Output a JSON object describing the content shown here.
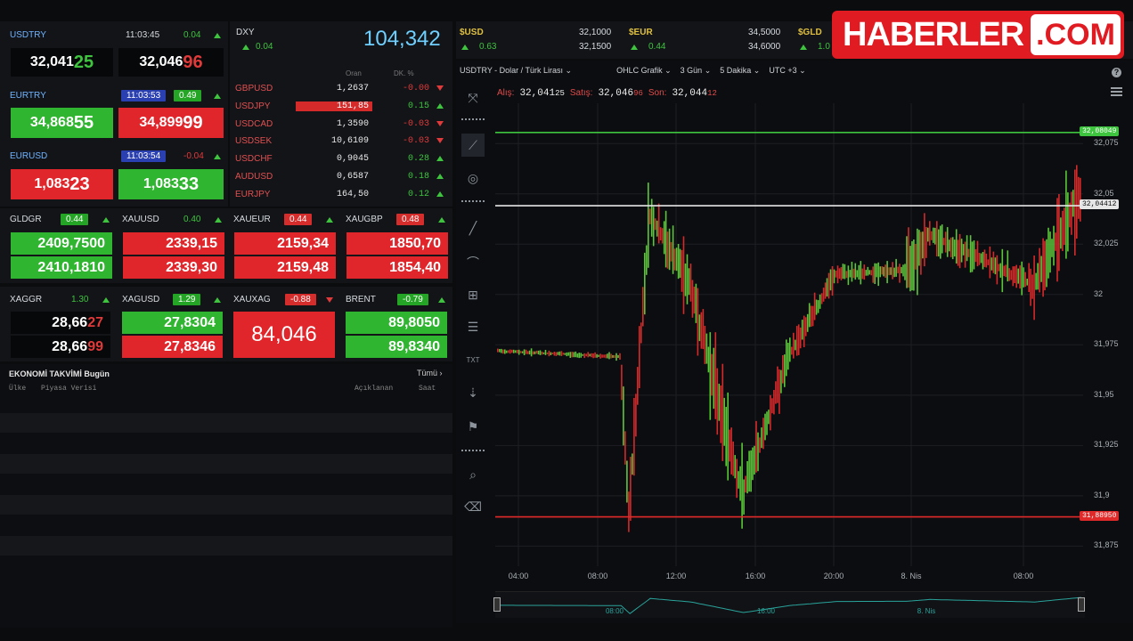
{
  "logo": {
    "brand": "HABERLER",
    "tld": ".COM"
  },
  "usdtry_card": {
    "name": "USDTRY",
    "time": "11:03:45",
    "change": "0.04",
    "bid_main": "32,041",
    "bid_tail": "25",
    "ask_main": "32,046",
    "ask_tail": "96"
  },
  "eurtry_card": {
    "name": "EURTRY",
    "time": "11:03:53",
    "change": "0.49",
    "bid_main": "34,868",
    "bid_tail": "55",
    "ask_main": "34,899",
    "ask_tail": "99"
  },
  "eurusd_card": {
    "name": "EURUSD",
    "time": "11:03:54",
    "change": "-0.04",
    "bid_main": "1,083",
    "bid_tail": "23",
    "ask_main": "1,083",
    "ask_tail": "33"
  },
  "dxy": {
    "name": "DXY",
    "change": "0.04",
    "value": "104,342",
    "col_price": "Oran",
    "col_change": "DK. %"
  },
  "fx_rows": [
    {
      "name": "GBPUSD",
      "value": "1,2637",
      "change": "-0.00",
      "dir": "down",
      "hl": false
    },
    {
      "name": "USDJPY",
      "value": "151,85",
      "change": "0.15",
      "dir": "up",
      "hl": true
    },
    {
      "name": "USDCAD",
      "value": "1,3590",
      "change": "-0.03",
      "dir": "down",
      "hl": false
    },
    {
      "name": "USDSEK",
      "value": "10,6109",
      "change": "-0.03",
      "dir": "down",
      "hl": false
    },
    {
      "name": "USDCHF",
      "value": "0,9045",
      "change": "0.28",
      "dir": "up",
      "hl": false
    },
    {
      "name": "AUDUSD",
      "value": "0,6587",
      "change": "0.18",
      "dir": "up",
      "hl": false
    },
    {
      "name": "EURJPY",
      "value": "164,50",
      "change": "0.12",
      "dir": "up",
      "hl": false
    }
  ],
  "metals": [
    {
      "name": "GLDGR",
      "change": "0.44",
      "bid": "2409,7500",
      "ask": "2410,1810"
    },
    {
      "name": "XAUUSD",
      "change": "0.40",
      "bid": "2339,15",
      "ask": "2339,30"
    },
    {
      "name": "XAUEUR",
      "change": "0.44",
      "bid": "2159,34",
      "ask": "2159,48"
    },
    {
      "name": "XAUGBP",
      "change": "0.48",
      "bid": "1850,70",
      "ask": "1854,40"
    }
  ],
  "silver": [
    {
      "name": "XAGGR",
      "change": "1.30",
      "bid_main": "28,66",
      "bid_tail": "27",
      "ask_main": "28,66",
      "ask_tail": "99"
    },
    {
      "name": "XAGUSD",
      "change": "1.29",
      "bid": "27,8304",
      "ask": "27,8346"
    },
    {
      "name": "XAUXAG",
      "change": "-0.88",
      "value": "84,046"
    },
    {
      "name": "BRENT",
      "change": "-0.79",
      "bid": "89,8050",
      "ask": "89,8340"
    }
  ],
  "calendar": {
    "title": "EKONOMİ TAKVİMİ",
    "period": "Bugün",
    "all_link": "Tümü ›",
    "col_country": "Ülke",
    "col_data": "Piyasa Verisi",
    "col_announced": "Açıklanan",
    "col_time": "Saat"
  },
  "top_quotes": [
    {
      "name": "$USD",
      "change": "0.63",
      "bid": "32,1000",
      "ask": "32,1500"
    },
    {
      "name": "$EUR",
      "change": "0.44",
      "bid": "34,5000",
      "ask": "34,6000"
    },
    {
      "name": "$GLD",
      "change": "1.0"
    }
  ],
  "chart_toolbar": {
    "symbol": "USDTRY - Dolar / Türk Lirası",
    "chart_type": "OHLC Grafik",
    "range": "3 Gün",
    "interval": "5 Dakika",
    "timezone": "UTC +3"
  },
  "quote_line": {
    "bid_label": "Alış:",
    "bid_main": "32,041",
    "bid_tail": "25",
    "ask_label": "Satış:",
    "ask_main": "32,046",
    "ask_tail": "96",
    "last_label": "Son:",
    "last_main": "32,044",
    "last_tail": "12"
  },
  "chart_data": {
    "type": "ohlc",
    "title": "USDTRY - Dolar / Türk Lirası",
    "y_ticks": [
      "32,075",
      "32,05",
      "32,025",
      "32",
      "31,975",
      "31,95",
      "31,925",
      "31,9",
      "31,875"
    ],
    "ylim": [
      31.865,
      32.095
    ],
    "x_ticks": [
      "04:00",
      "08:00",
      "12:00",
      "16:00",
      "20:00",
      "8. Nis",
      "08:00"
    ],
    "nav_ticks": [
      "08:00",
      "16:00",
      "8. Nis"
    ],
    "hlines": [
      {
        "label": "32,08049",
        "value": 32.08049,
        "color": "#3ec43e"
      },
      {
        "label": "32,04412",
        "value": 32.04412,
        "color": "#e6e6e6"
      },
      {
        "label": "31,88950",
        "value": 31.8895,
        "color": "#e02a2a"
      }
    ],
    "segments": [
      {
        "from": 0,
        "to": 0.21,
        "start": 31.972,
        "end": 31.969,
        "vol": 0.002
      },
      {
        "from": 0.21,
        "to": 0.225,
        "start": 31.969,
        "end": 31.89,
        "vol": 0.018
      },
      {
        "from": 0.225,
        "to": 0.26,
        "start": 31.89,
        "end": 32.04,
        "vol": 0.025
      },
      {
        "from": 0.26,
        "to": 0.33,
        "start": 32.04,
        "end": 32.005,
        "vol": 0.018
      },
      {
        "from": 0.33,
        "to": 0.42,
        "start": 32.005,
        "end": 31.9,
        "vol": 0.025
      },
      {
        "from": 0.42,
        "to": 0.5,
        "start": 31.9,
        "end": 31.97,
        "vol": 0.014
      },
      {
        "from": 0.5,
        "to": 0.58,
        "start": 31.97,
        "end": 32.01,
        "vol": 0.009
      },
      {
        "from": 0.58,
        "to": 0.7,
        "start": 32.01,
        "end": 32.012,
        "vol": 0.006
      },
      {
        "from": 0.7,
        "to": 0.74,
        "start": 32.012,
        "end": 32.03,
        "vol": 0.02
      },
      {
        "from": 0.74,
        "to": 0.92,
        "start": 32.03,
        "end": 32.005,
        "vol": 0.01
      },
      {
        "from": 0.92,
        "to": 1.0,
        "start": 32.005,
        "end": 32.05,
        "vol": 0.022
      }
    ]
  }
}
